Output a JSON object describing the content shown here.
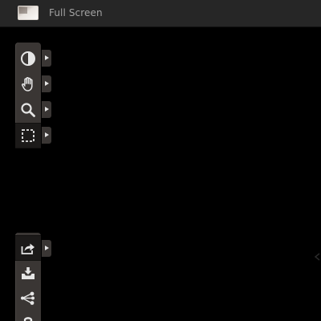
{
  "header": {
    "fullscreen_label": "Full Screen"
  },
  "toolbar_top": {
    "tools": [
      {
        "name": "window-level",
        "icon": "contrast-icon",
        "active": false
      },
      {
        "name": "pan",
        "icon": "hand-icon",
        "active": false
      },
      {
        "name": "zoom",
        "icon": "magnifier-icon",
        "active": false
      },
      {
        "name": "select",
        "icon": "marquee-select-icon",
        "active": true
      }
    ]
  },
  "toolbar_bottom": {
    "tools": [
      {
        "name": "share",
        "icon": "share-arrow-icon",
        "active": true
      },
      {
        "name": "download",
        "icon": "tray-download-icon",
        "active": false
      },
      {
        "name": "workflow",
        "icon": "network-icon",
        "active": false
      },
      {
        "name": "help",
        "icon": "question-icon",
        "active": false
      }
    ]
  },
  "colors": {
    "background": "#000000",
    "header": "#262626",
    "header_text": "#a3a3a3",
    "toolbar": "#3a3634",
    "icon": "#e6e6e6"
  }
}
